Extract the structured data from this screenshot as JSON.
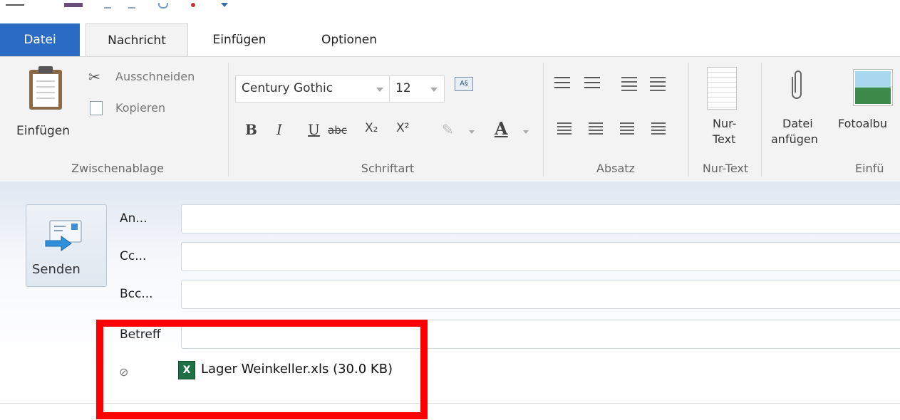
{
  "tabs": {
    "file": "Datei",
    "message": "Nachricht",
    "insert": "Einfügen",
    "options": "Optionen"
  },
  "clipboard": {
    "paste": "Einfügen",
    "cut": "Ausschneiden",
    "copy": "Kopieren",
    "group": "Zwischenablage"
  },
  "font": {
    "family": "Century Gothic",
    "size": "12",
    "group": "Schriftart",
    "bold": "B",
    "italic": "I",
    "underline": "U",
    "strikethrough": "abc",
    "subscript": "X₂",
    "superscript": "X²",
    "color": "A"
  },
  "paragraph": {
    "group": "Absatz"
  },
  "plaintext": {
    "label_line1": "Nur-",
    "label_line2": "Text",
    "group": "Nur-Text"
  },
  "attach": {
    "label_line1": "Datei",
    "label_line2": "anfügen"
  },
  "photoalbum": {
    "label": "Fotoalbu"
  },
  "insert_group": {
    "label": "Einfü"
  },
  "compose": {
    "send": "Senden",
    "to": "An...",
    "cc": "Cc...",
    "bcc": "Bcc...",
    "subject": "Betreff",
    "attachment_name": "Lager Weinkeller.xls (30.0 KB)"
  },
  "colors": {
    "file_tab": "#2b6bc4",
    "highlight": "#ff0000",
    "excel": "#1e7145"
  }
}
